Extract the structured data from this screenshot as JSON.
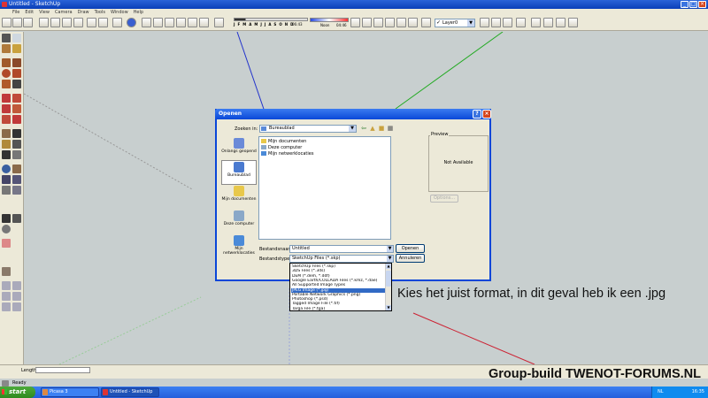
{
  "app": {
    "title": "Untitled - SketchUp",
    "menu": [
      "File",
      "Edit",
      "View",
      "Camera",
      "Draw",
      "Tools",
      "Window",
      "Help"
    ]
  },
  "toolbar": {
    "months": [
      "J",
      "F",
      "M",
      "A",
      "M",
      "J",
      "J",
      "A",
      "S",
      "O",
      "N",
      "D"
    ],
    "time_start": "06:43",
    "noon_label": "Noon",
    "time_end": "04:46",
    "layer": "Layer0"
  },
  "dialog": {
    "title": "Openen",
    "look_in_label": "Zoeken in:",
    "look_in_value": "Bureaublad",
    "places": [
      {
        "label": "Onlangs geopend"
      },
      {
        "label": "Bureaublad"
      },
      {
        "label": "Mijn documenten"
      },
      {
        "label": "Deze computer"
      },
      {
        "label": "Mijn netwerklocaties"
      }
    ],
    "files": [
      "Mijn documenten",
      "Deze computer",
      "Mijn netwerklocaties"
    ],
    "preview_label": "Preview",
    "preview_text": "Not Available",
    "options_label": "Options...",
    "filename_label": "Bestandsnaam:",
    "filename_value": "Untitled",
    "filetype_label": "Bestandstypen:",
    "filetype_value": "SketchUp Files (*.skp)",
    "open_label": "Openen",
    "cancel_label": "Annuleren",
    "filetypes": [
      "SketchUp Files (*.skp)",
      "3DS Files (*.3ds)",
      "DEM (*.dem, *.ddf)",
      "Google Earth/COLLADA Files (*.kmz, *.dae)",
      "All Supported Image Types",
      "JPEG Image (*.jpg)",
      "Portable Network Graphics (*.png)",
      "Photoshop (*.psd)",
      "Tagged Image File (*.tif)",
      "Targa File (*.tga)"
    ],
    "filetype_selected": 5
  },
  "annotation": "Kies het juist format, in dit geval heb ik een .jpg",
  "status": {
    "length_label": "Length",
    "ready": "Ready"
  },
  "watermark": "Group-build TWENOT-FORUMS.NL",
  "taskbar": {
    "start": "start",
    "tasks": [
      "Picasa 3",
      "Untitled - SketchUp"
    ],
    "lang": "NL",
    "clock": "16:35"
  },
  "colors": {
    "axis_blue": "#2233cc",
    "axis_green": "#22aa22",
    "axis_red": "#cc2233",
    "dialog_border": "#0a46d8",
    "selection": "#316ac5"
  }
}
